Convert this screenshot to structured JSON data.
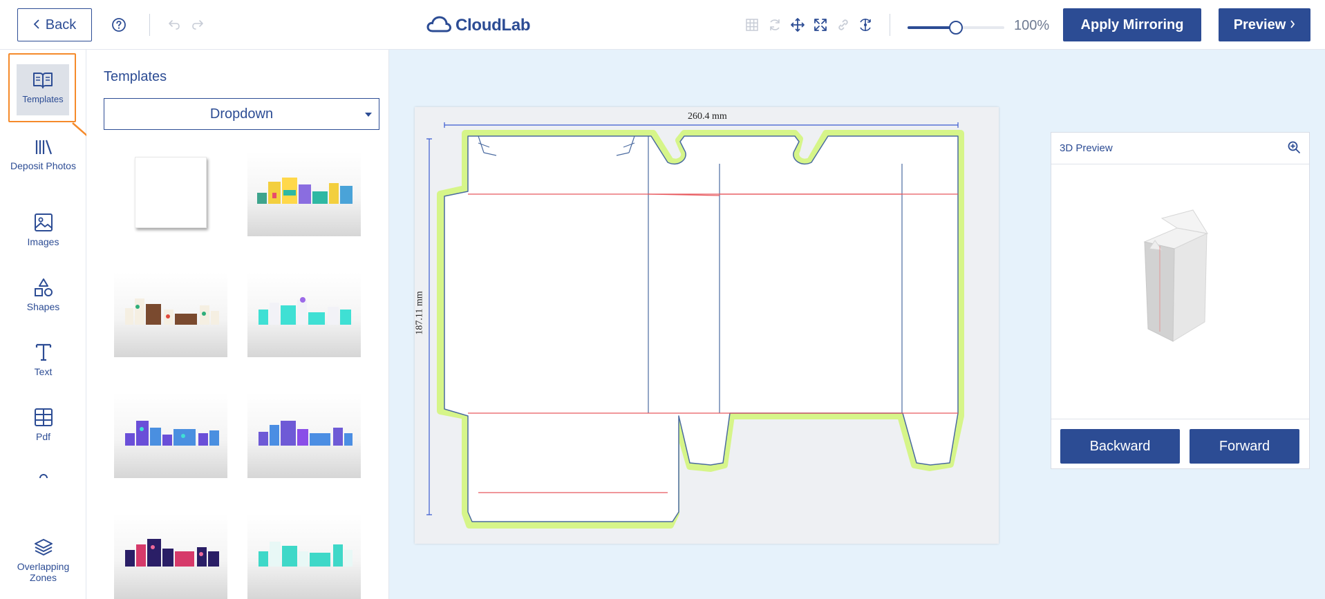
{
  "header": {
    "back_label": "Back",
    "logo_text": "CloudLab",
    "zoom_value": 0.5,
    "zoom_label": "100%",
    "apply_mirroring_label": "Apply Mirroring",
    "preview_label": "Preview"
  },
  "sidebar": {
    "items": [
      {
        "label": "Templates",
        "icon": "book-open-icon"
      },
      {
        "label": "Deposit Photos",
        "icon": "library-icon"
      },
      {
        "label": "Images",
        "icon": "image-icon"
      },
      {
        "label": "Shapes",
        "icon": "shapes-icon"
      },
      {
        "label": "Text",
        "icon": "text-icon"
      },
      {
        "label": "Pdf",
        "icon": "table-icon"
      },
      {
        "label": "Overlapping Zones",
        "icon": "layers-icon"
      }
    ],
    "active_item": "Templates"
  },
  "templates": {
    "title": "Templates",
    "dropdown_value": "Dropdown"
  },
  "dieline": {
    "width_label": "260.4 mm",
    "height_label": "187.11 mm"
  },
  "preview3d": {
    "title": "3D Preview",
    "backward_label": "Backward",
    "forward_label": "Forward"
  },
  "colors": {
    "brand": "#2c4c94",
    "highlight": "#f58a2a",
    "bleed": "#d6f589",
    "fold_line": "#e8585d",
    "workarea_bg": "#e6f2fb"
  }
}
